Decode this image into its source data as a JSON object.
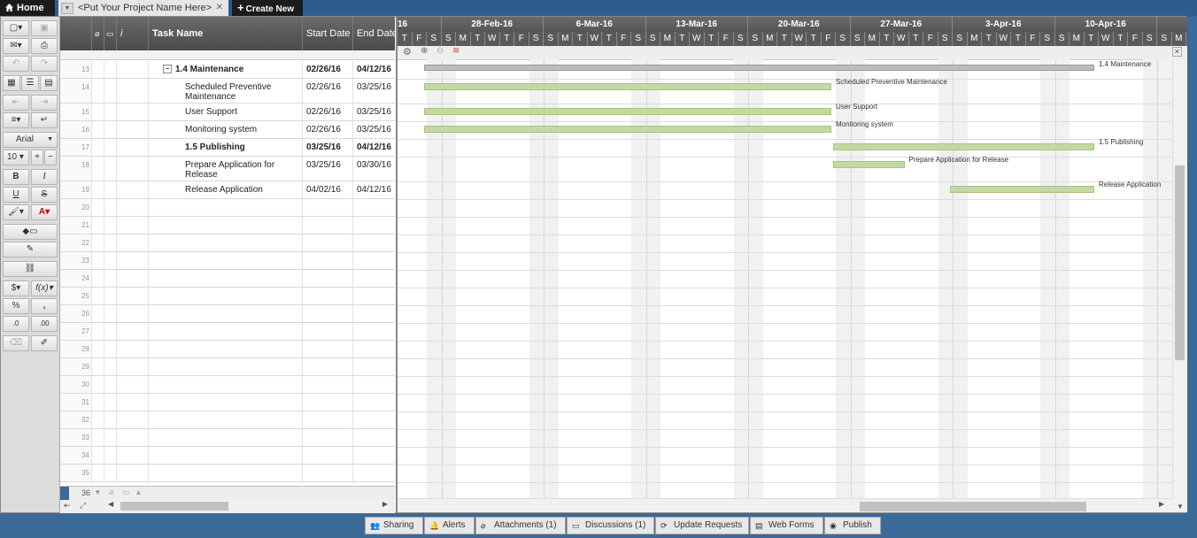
{
  "tabs": {
    "home": "Home",
    "project": "<Put Your Project Name Here>",
    "create": "Create New"
  },
  "toolbar": {
    "font": "Arial",
    "size": "10"
  },
  "grid": {
    "headers": {
      "task": "Task Name",
      "start": "Start Date",
      "end": "End Date"
    },
    "rows": [
      {
        "num": "13",
        "task": "1.4 Maintenance",
        "start": "02/26/16",
        "end": "04/12/16",
        "bold": true,
        "summary": true
      },
      {
        "num": "14",
        "task": "Scheduled Preventive Maintenance",
        "start": "02/26/16",
        "end": "03/25/16"
      },
      {
        "num": "15",
        "task": "User Support",
        "start": "02/26/16",
        "end": "03/25/16"
      },
      {
        "num": "16",
        "task": "Monitoring system",
        "start": "02/26/16",
        "end": "03/25/16"
      },
      {
        "num": "17",
        "task": "1.5 Publishing",
        "start": "03/25/16",
        "end": "04/12/16",
        "bold": true
      },
      {
        "num": "18",
        "task": "Prepare Application for Release",
        "start": "03/25/16",
        "end": "03/30/16"
      },
      {
        "num": "19",
        "task": "Release Application",
        "start": "04/02/16",
        "end": "04/12/16"
      },
      {
        "num": "20"
      },
      {
        "num": "21"
      },
      {
        "num": "22"
      },
      {
        "num": "23"
      },
      {
        "num": "24"
      },
      {
        "num": "25"
      },
      {
        "num": "26"
      },
      {
        "num": "27"
      },
      {
        "num": "28"
      },
      {
        "num": "29"
      },
      {
        "num": "30"
      },
      {
        "num": "31"
      },
      {
        "num": "32"
      },
      {
        "num": "33"
      },
      {
        "num": "34"
      },
      {
        "num": "35"
      }
    ],
    "footer_rows": "36"
  },
  "gantt": {
    "weeks": [
      "16",
      "28-Feb-16",
      "6-Mar-16",
      "13-Mar-16",
      "20-Mar-16",
      "27-Mar-16",
      "3-Apr-16",
      "10-Apr-16"
    ],
    "days": [
      "T",
      "F",
      "S",
      "S",
      "M",
      "T",
      "W",
      "T",
      "F",
      "S",
      "S",
      "M",
      "T",
      "W",
      "T",
      "F",
      "S",
      "S",
      "M",
      "T",
      "W",
      "T",
      "F",
      "S",
      "S",
      "M",
      "T",
      "W",
      "T",
      "F",
      "S",
      "S",
      "M",
      "T",
      "W",
      "T",
      "F",
      "S",
      "S",
      "M",
      "T",
      "W",
      "T",
      "F",
      "S",
      "S",
      "M",
      "T",
      "W",
      "T",
      "F",
      "S",
      "S",
      "M"
    ],
    "bars": [
      {
        "label": "1.4 Maintenance",
        "start": "02/26/16",
        "end": "04/12/16",
        "summary": true
      },
      {
        "label": "Scheduled Preventive Maintenance",
        "start": "02/26/16",
        "end": "03/25/16"
      },
      {
        "label": "User Support",
        "start": "02/26/16",
        "end": "03/25/16"
      },
      {
        "label": "Monitoring system",
        "start": "02/26/16",
        "end": "03/25/16"
      },
      {
        "label": "1.5 Publishing",
        "start": "03/25/16",
        "end": "04/12/16"
      },
      {
        "label": "Prepare Application for Release",
        "start": "03/25/16",
        "end": "03/30/16"
      },
      {
        "label": "Release Application",
        "start": "04/02/16",
        "end": "04/12/16"
      }
    ]
  },
  "bottom_tabs": [
    "Sharing",
    "Alerts",
    "Attachments (1)",
    "Discussions (1)",
    "Update Requests",
    "Web Forms",
    "Publish"
  ]
}
